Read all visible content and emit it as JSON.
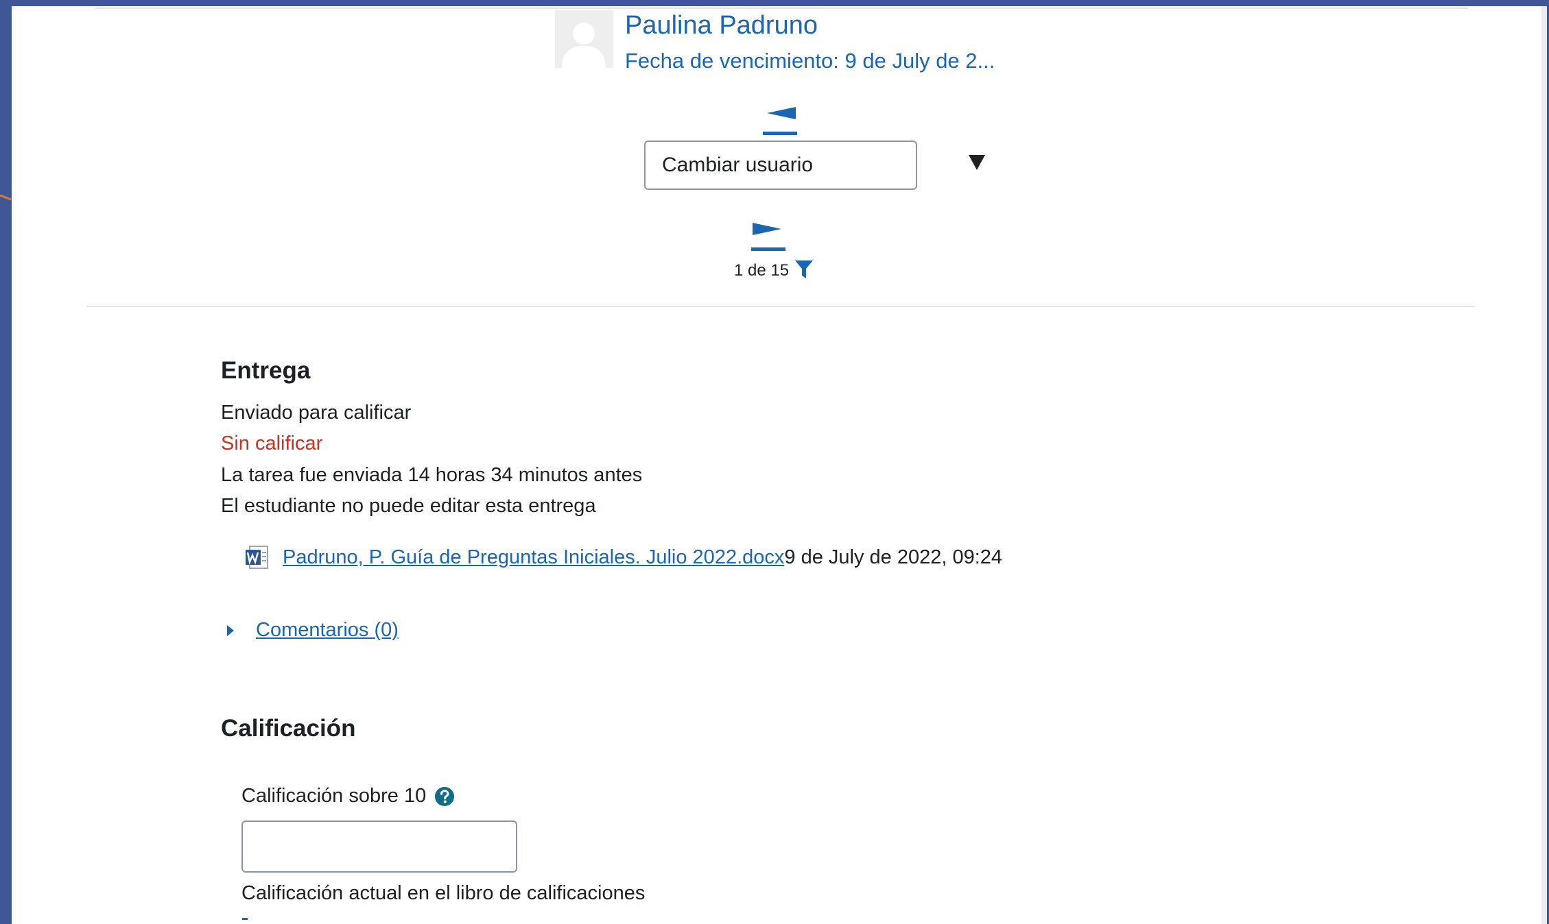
{
  "header": {
    "user_name": "Paulina Padruno",
    "due_date": "Fecha de vencimiento: 9 de July de 2..."
  },
  "navigation": {
    "user_select": {
      "selected": "Cambiar usuario"
    },
    "counter": "1 de 15"
  },
  "submission": {
    "title": "Entrega",
    "status": "Enviado para calificar",
    "grading_status": "Sin calificar",
    "time_info": "La tarea fue enviada 14 horas 34 minutos antes",
    "edit_info": "El estudiante no puede editar esta entrega",
    "file": {
      "name": "Padruno, P. Guía de Preguntas Iniciales. Julio 2022.docx",
      "date": "9 de July de 2022, 09:24"
    },
    "comments_label": "Comentarios (0)"
  },
  "grade": {
    "title": "Calificación",
    "label": "Calificación sobre 10",
    "value": "",
    "current_label": "Calificación actual en el libro de calificaciones"
  },
  "colors": {
    "link": "#1a66b5",
    "danger": "#ca3120",
    "outer_background": "#3f5797",
    "help_icon": "#0f6e84"
  },
  "icons": {
    "prev_user": "previous-user-icon",
    "next_user": "next-user-icon",
    "dropdown": "caret-down-icon",
    "filter": "filter-icon",
    "file": "word-document-icon",
    "expand": "caret-right-icon",
    "help": "help-icon"
  }
}
